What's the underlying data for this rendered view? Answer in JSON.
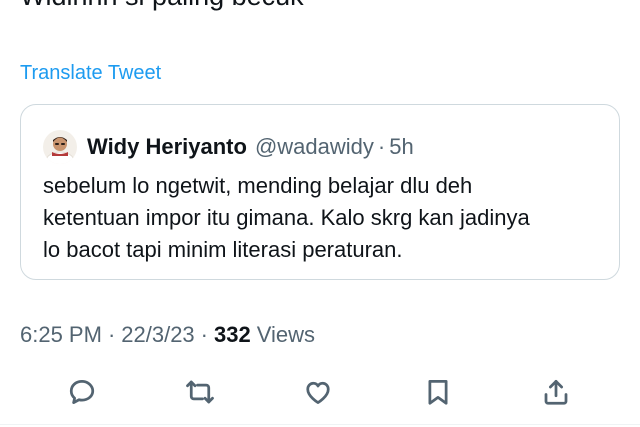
{
  "tweet": {
    "text": "Widihhh si paling becuk",
    "translate_label": "Translate Tweet"
  },
  "quoted_tweet": {
    "author_name": "Widy Heriyanto",
    "author_handle": "@wadawidy",
    "separator": "·",
    "time_ago": "5h",
    "lines": [
      "sebelum lo ngetwit, mending belajar dlu deh",
      "ketentuan impor itu gimana. Kalo skrg kan jadinya",
      "lo bacot tapi minim literasi peraturan."
    ]
  },
  "meta": {
    "time": "6:25 PM",
    "separator": "·",
    "date": "22/3/23",
    "views_count": "332",
    "views_label": "Views"
  },
  "actions": {
    "icons": [
      "reply-icon",
      "retweet-icon",
      "like-icon",
      "bookmark-icon",
      "share-icon"
    ],
    "icon_color": "#536471"
  },
  "colors": {
    "link": "#1d9bf0",
    "secondary_text": "#536471",
    "border": "#cfd9de"
  }
}
